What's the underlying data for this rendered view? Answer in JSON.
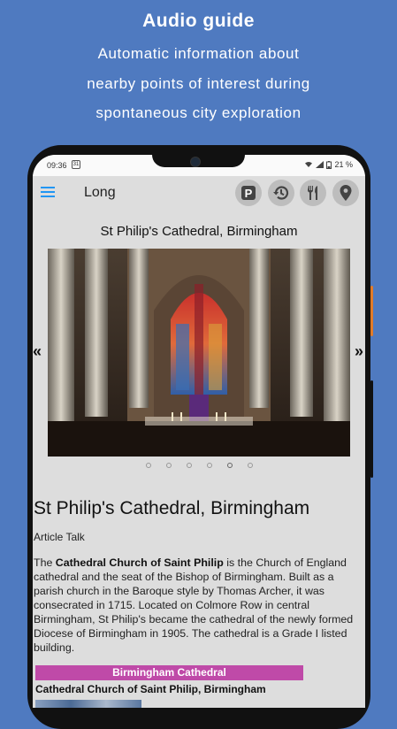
{
  "promo": {
    "title": "Audio guide",
    "lines": [
      "Automatic information about",
      "nearby points of interest during",
      "spontaneous city exploration"
    ]
  },
  "statusbar": {
    "time": "09:36",
    "battery": "21 %"
  },
  "appbar": {
    "title": "Long",
    "buttons": [
      "parking-icon",
      "history-icon",
      "restaurant-icon",
      "location-pin-icon"
    ]
  },
  "place": {
    "title": "St Philip's Cathedral, Birmingham",
    "prev_label": "«",
    "next_label": "»",
    "carousel_count": 6,
    "carousel_active": 5
  },
  "article": {
    "title": "St Philip's Cathedral, Birmingham",
    "tabs": "Article Talk",
    "intro_pre": "The ",
    "intro_bold": "Cathedral Church of Saint Philip",
    "intro_post": " is the Church of England cathedral and the seat of the Bishop of Birmingham. Built as a parish church in the Baroque style by Thomas Archer, it was consecrated in 1715. Located on Colmore Row in central Birmingham, St Philip's became the cathedral of the newly formed Diocese of Birmingham in 1905. The cathedral is a Grade I listed building.",
    "infobox_title": "Birmingham Cathedral",
    "infobox_subtitle": "Cathedral Church of Saint Philip, Birmingham"
  },
  "colors": {
    "background": "#4f7ac0",
    "accent": "#2196f3",
    "infobox": "#bf4aa8"
  }
}
